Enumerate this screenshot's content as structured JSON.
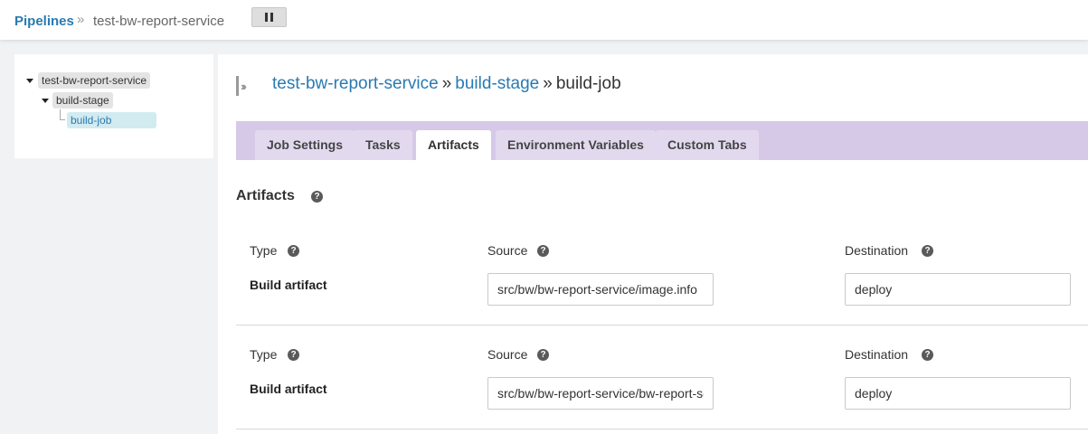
{
  "header": {
    "breadcrumb_link": "Pipelines",
    "breadcrumb_sep": "»",
    "breadcrumb_current": "test-bw-report-service"
  },
  "tree": {
    "pipeline": "test-bw-report-service",
    "stage": "build-stage",
    "job": "build-job"
  },
  "title": {
    "pipeline": "test-bw-report-service",
    "sep": "»",
    "stage": "build-stage",
    "job": "build-job"
  },
  "tabs": [
    {
      "label": "Job Settings",
      "active": false
    },
    {
      "label": "Tasks",
      "active": false
    },
    {
      "label": "Artifacts",
      "active": true
    },
    {
      "label": "Environment Variables",
      "active": false
    },
    {
      "label": "Custom Tabs",
      "active": false
    }
  ],
  "section": {
    "title": "Artifacts",
    "help_glyph": "?"
  },
  "labels": {
    "type": "Type",
    "source": "Source",
    "destination": "Destination"
  },
  "artifacts": [
    {
      "type": "Build artifact",
      "source": "src/bw/bw-report-service/image.info",
      "destination": "deploy"
    },
    {
      "type": "Build artifact",
      "source": "src/bw/bw-report-service/bw-report-service",
      "destination": "deploy"
    }
  ],
  "colors": {
    "link": "#2a7ab0",
    "tab_bar": "#d6c9e8",
    "tab": "#e3d9ef",
    "tree_active": "#d2ebf0"
  },
  "icons": {
    "pause": "pause-icon",
    "pipeline": "pipeline-icon",
    "help": "help-icon"
  }
}
